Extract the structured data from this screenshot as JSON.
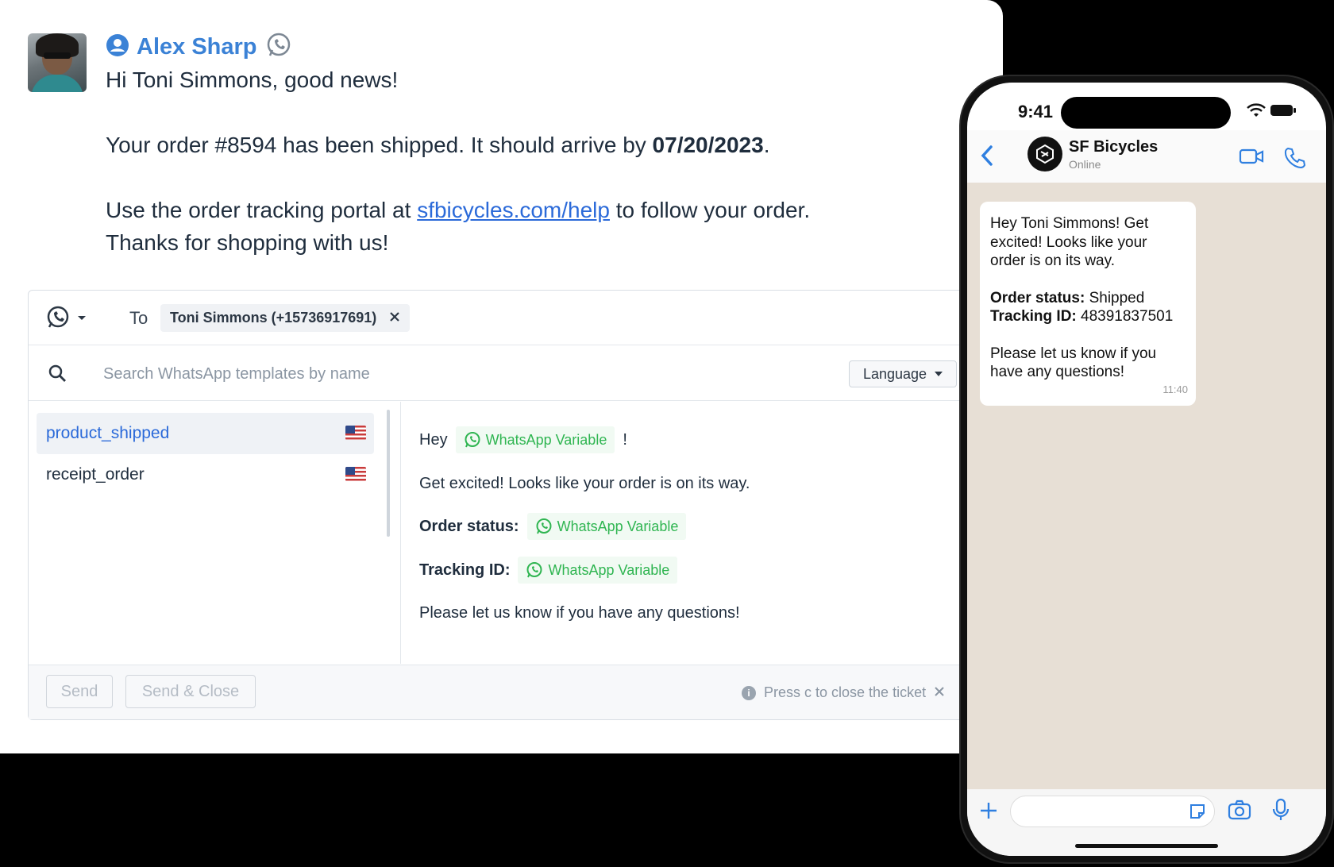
{
  "ticket": {
    "sender_name": "Alex Sharp",
    "greeting": "Hi Toni Simmons, good news!",
    "line2_pre": "Your order #8594 has been shipped. It should arrive by ",
    "line2_date": "07/20/2023",
    "line2_post": ".",
    "line3_pre": "Use the order tracking portal at ",
    "line3_link": "sfbicycles.com/help",
    "line3_post": " to follow your order.",
    "line4": "Thanks for shopping with us!"
  },
  "composer": {
    "to_label": "To",
    "recipient": "Toni Simmons (+15736917691)",
    "search_placeholder": "Search WhatsApp templates by name",
    "language_label": "Language",
    "templates": [
      {
        "name": "product_shipped",
        "selected": true
      },
      {
        "name": "receipt_order",
        "selected": false
      }
    ],
    "preview": {
      "hey": "Hey",
      "exclaim": "!",
      "variable_label": "WhatsApp Variable",
      "line2": "Get excited! Looks like your order is on its way.",
      "order_status_label": "Order status:",
      "tracking_label": "Tracking ID:",
      "line5": "Please let us know if you have any questions!"
    },
    "send_label": "Send",
    "send_close_label": "Send & Close",
    "hint": "Press c to close the ticket"
  },
  "phone": {
    "time": "9:41",
    "contact_name": "SF Bicycles",
    "contact_status": "Online",
    "bubble": {
      "line1": "Hey Toni Simmons! Get excited! Looks like your order is on its way.",
      "order_status_label": "Order status:",
      "order_status_value": " Shipped",
      "tracking_label": "Tracking ID:",
      "tracking_value": " 48391837501",
      "closing": "Please let us know if you have any questions!",
      "time": "11:40"
    }
  },
  "colors": {
    "accent_blue": "#3b82d6",
    "link_blue": "#2b6ad9",
    "whatsapp_green": "#2fb551",
    "chat_background": "#e7dfd5"
  },
  "icons": [
    "user-icon",
    "whatsapp-icon",
    "chevron-down-icon",
    "close-icon",
    "search-icon",
    "us-flag-icon",
    "info-icon",
    "back-icon",
    "video-icon",
    "phone-icon",
    "plus-icon",
    "sticker-icon",
    "camera-icon",
    "mic-icon",
    "wifi-icon",
    "battery-icon"
  ]
}
